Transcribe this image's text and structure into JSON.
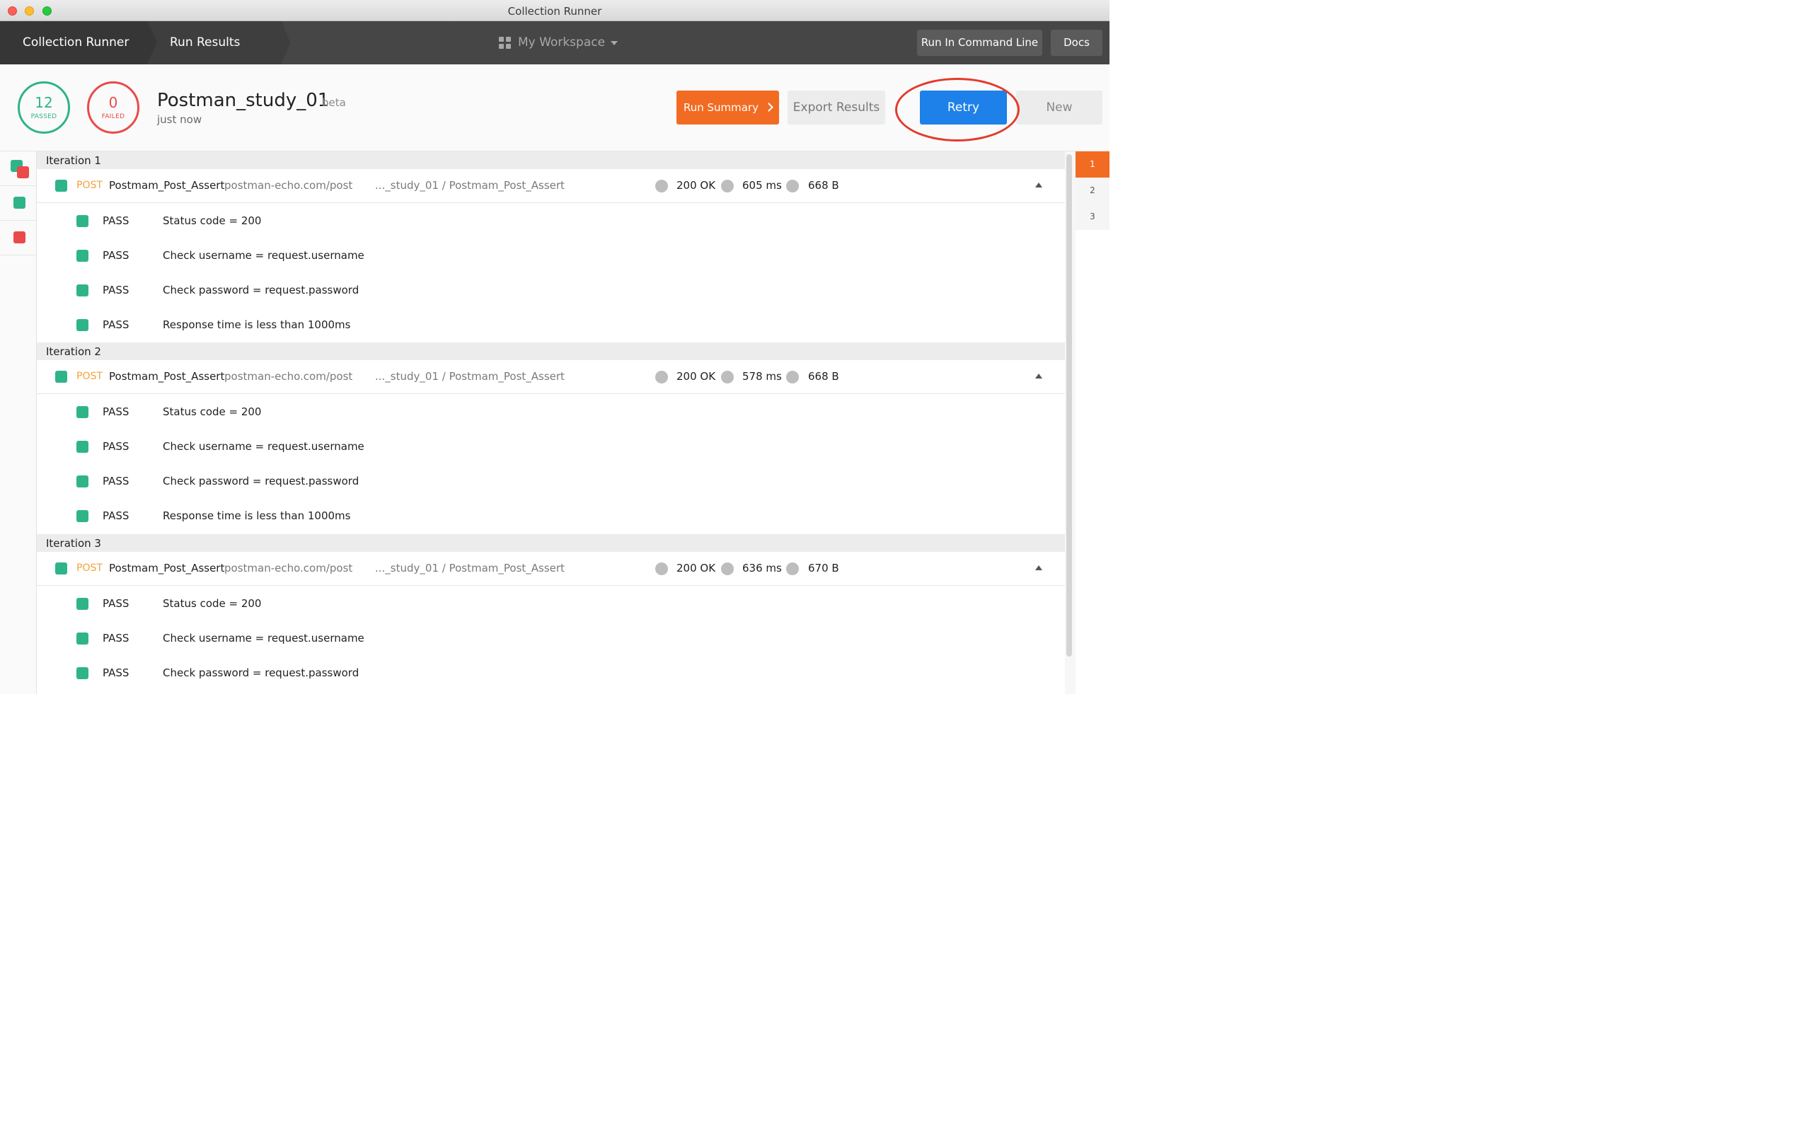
{
  "window": {
    "title": "Collection Runner"
  },
  "header": {
    "breadcrumbs": [
      "Collection Runner",
      "Run Results"
    ],
    "workspace": "My Workspace",
    "run_cli_label": "Run In Command Line",
    "docs_label": "Docs"
  },
  "summary": {
    "passed_count": "12",
    "passed_label": "PASSED",
    "failed_count": "0",
    "failed_label": "FAILED",
    "run_name": "Postman_study_01",
    "beta_label": "beta",
    "time": "just now",
    "run_summary_label": "Run Summary",
    "export_label": "Export Results",
    "retry_label": "Retry",
    "new_label": "New"
  },
  "iterations": [
    {
      "title": "Iteration 1",
      "request": {
        "method": "POST",
        "name": "Postmam_Post_Assert",
        "url": "postman-echo.com/post",
        "path": "..._study_01 / Postmam_Post_Assert",
        "status": "200 OK",
        "time": "605 ms",
        "size": "668 B"
      },
      "tests": [
        {
          "result": "PASS",
          "name": "Status code = 200"
        },
        {
          "result": "PASS",
          "name": "Check username = request.username"
        },
        {
          "result": "PASS",
          "name": "Check password = request.password"
        },
        {
          "result": "PASS",
          "name": "Response time is less than 1000ms"
        }
      ]
    },
    {
      "title": "Iteration 2",
      "request": {
        "method": "POST",
        "name": "Postmam_Post_Assert",
        "url": "postman-echo.com/post",
        "path": "..._study_01 / Postmam_Post_Assert",
        "status": "200 OK",
        "time": "578 ms",
        "size": "668 B"
      },
      "tests": [
        {
          "result": "PASS",
          "name": "Status code = 200"
        },
        {
          "result": "PASS",
          "name": "Check username = request.username"
        },
        {
          "result": "PASS",
          "name": "Check password = request.password"
        },
        {
          "result": "PASS",
          "name": "Response time is less than 1000ms"
        }
      ]
    },
    {
      "title": "Iteration 3",
      "request": {
        "method": "POST",
        "name": "Postmam_Post_Assert",
        "url": "postman-echo.com/post",
        "path": "..._study_01 / Postmam_Post_Assert",
        "status": "200 OK",
        "time": "636 ms",
        "size": "670 B"
      },
      "tests": [
        {
          "result": "PASS",
          "name": "Status code = 200"
        },
        {
          "result": "PASS",
          "name": "Check username = request.username"
        },
        {
          "result": "PASS",
          "name": "Check password = request.password"
        }
      ]
    }
  ],
  "iteration_picker": [
    "1",
    "2",
    "3"
  ],
  "colors": {
    "pass": "#2fb48a",
    "fail": "#ea4a4a",
    "accent": "#f26b22",
    "primary": "#1e80e9",
    "method": "#f2a23b"
  },
  "icons": [
    "workspace-grid-icon",
    "dropdown-caret-icon",
    "chevron-right-icon",
    "collapse-arrow-icon",
    "status-square-icon"
  ]
}
